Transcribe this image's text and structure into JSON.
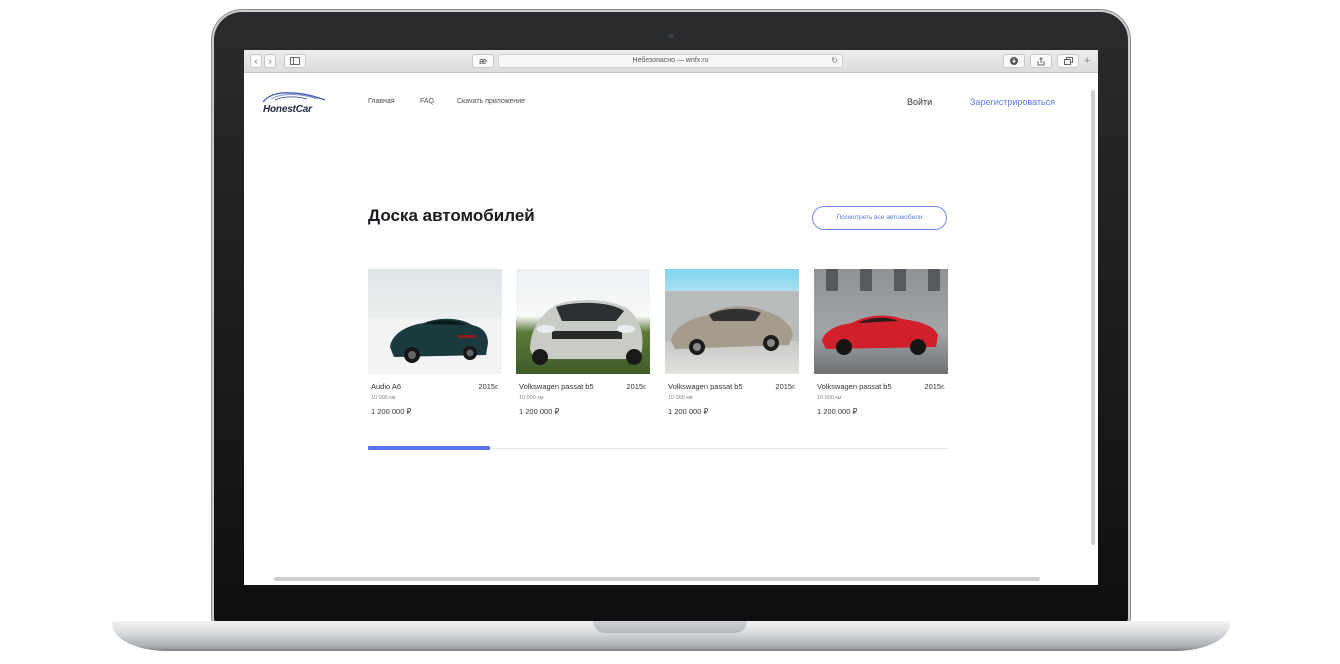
{
  "browser": {
    "address": "Небезопасно — wnfx.ru",
    "reader_label": "æ"
  },
  "header": {
    "logo_text": "HonestCar",
    "nav": [
      "Главная",
      "FAQ",
      "Скачать приложение"
    ],
    "login_label": "Войти",
    "register_label": "Зарегистрироваться"
  },
  "section": {
    "title": "Доска автомобилей",
    "view_all_label": "Посмотреть все автомобили"
  },
  "cars": [
    {
      "name": "Audio A6",
      "year": "2015г.",
      "mileage": "10 000 км",
      "price": "1 200 000 ₽",
      "color": "#1b3a40"
    },
    {
      "name": "Volkswagen passat b5",
      "year": "2015г.",
      "mileage": "10 000 км",
      "price": "1 200 000 ₽",
      "color": "#c9cbc6"
    },
    {
      "name": "Volkswagen passat b5",
      "year": "2015г.",
      "mileage": "10 000 км",
      "price": "1 200 000 ₽",
      "color": "#a69c8c"
    },
    {
      "name": "Volkswagen passat b5",
      "year": "2015г.",
      "mileage": "10 000 км",
      "price": "1 200 000 ₽",
      "color": "#d11f2b"
    }
  ],
  "carousel": {
    "progress_percent": 21
  },
  "colors": {
    "accent": "#5b7cf0",
    "progress": "#5a72ef"
  }
}
